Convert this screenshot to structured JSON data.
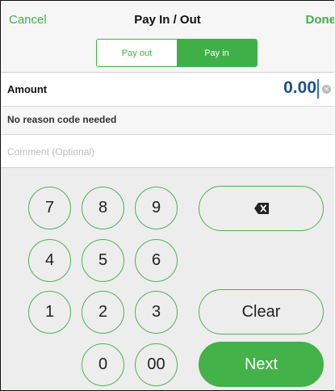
{
  "nav": {
    "cancel": "Cancel",
    "title": "Pay In / Out",
    "done": "Done"
  },
  "segmented": {
    "pay_out": "Pay out",
    "pay_in": "Pay in",
    "selected": "pay_in"
  },
  "amount": {
    "label": "Amount",
    "value": "0.00"
  },
  "reason": {
    "text": "No reason code needed"
  },
  "comment": {
    "placeholder": "Comment (Optional)",
    "value": ""
  },
  "keypad": {
    "keys": [
      "7",
      "8",
      "9",
      "4",
      "5",
      "6",
      "1",
      "2",
      "3",
      "0",
      "00"
    ],
    "clear": "Clear",
    "next": "Next",
    "backspace_icon": "backspace-icon"
  },
  "colors": {
    "accent": "#3fb047",
    "amount_text": "#1f4f8a",
    "keypad_bg": "#ededed"
  }
}
